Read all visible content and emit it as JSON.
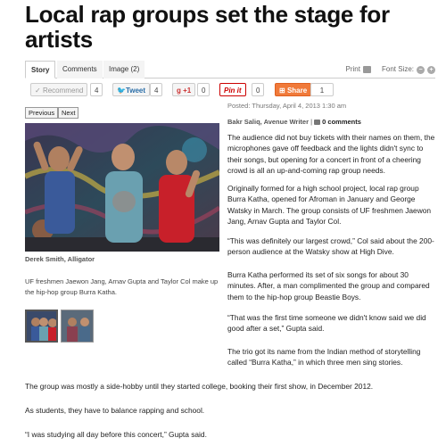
{
  "article": {
    "headline": "Local rap groups set the stage for artists",
    "posted": "Posted: Thursday, April 4, 2013 1:30 am",
    "author": "Bakr Saliq, Avenue Writer",
    "byline_sep": " | ",
    "comments": "0 comments",
    "paragraphs_col": [
      "The audience did not buy tickets with their names on them, the microphones gave off feedback and the lights didn't sync to their songs, but opening for a concert in front of a cheering crowd is all an up-and-coming rap group needs.",
      "Originally formed for a high school project, local rap group Burra Katha, opened for Afroman in January and George Watsky in March. The group consists of UF freshmen Jaewon Jang, Arnav Gupta and Taylor Col.",
      "“This was definitely our largest crowd,” Col said about the 200-person audience at the Watsky show at High Dive.",
      "Burra Katha performed its set of six songs for about 30 minutes. After, a man complimented the group and compared them to the hip-hop group Beastie Boys.",
      "“That was the first time someone we didn't know said we did good after a set,” Gupta said.",
      "The trio got its name from the Indian method of storytelling called “Burra Katha,” in which three men sing stories."
    ],
    "paragraphs_full": [
      "The group was mostly a side-hobby until they started college, booking their first show, in December 2012.",
      "As students, they have to balance rapping and school.",
      "“I was studying all day before this concert,” Gupta said."
    ]
  },
  "tabs": [
    {
      "label": "Story",
      "active": true
    },
    {
      "label": "Comments",
      "active": false
    },
    {
      "label": "Image (2)",
      "active": false
    }
  ],
  "tools": {
    "print": "Print",
    "font_size": "Font Size:",
    "minus": "−",
    "plus": "+"
  },
  "share": {
    "recommend": "Recommend",
    "recommend_count": "4",
    "tweet": "Tweet",
    "tweet_count": "4",
    "gplus": "+1",
    "gplus_count": "0",
    "pinit": "Pin it",
    "pinit_count": "0",
    "share": "Share",
    "share_count": "1"
  },
  "gallery": {
    "previous": "Previous",
    "next": "Next",
    "credit": "Derek Smith, Alligator",
    "caption": "UF freshmen Jaewon Jang, Arnav Gupta and Taylor Col make up the hip-hop group Burra Katha."
  }
}
